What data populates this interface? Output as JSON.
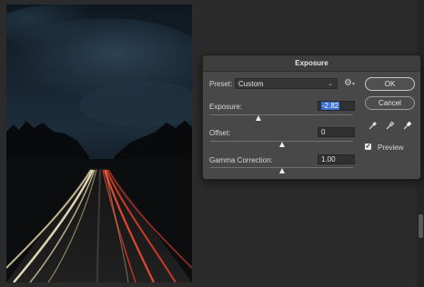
{
  "dialog": {
    "title": "Exposure",
    "preset_label": "Preset:",
    "preset_value": "Custom",
    "exposure": {
      "label": "Exposure:",
      "value": "-2.82",
      "level": 0.34
    },
    "offset": {
      "label": "Offset:",
      "value": "0",
      "level": 0.5
    },
    "gamma": {
      "label": "Gamma Correction:",
      "value": "1.00",
      "level": 0.5
    },
    "ok_label": "OK",
    "cancel_label": "Cancel",
    "preview_label": "Preview",
    "preview_checked": true
  },
  "icons": {
    "preset_menu": "gear-icon",
    "eyedroppers": [
      "black-point-eyedropper-icon",
      "gray-point-eyedropper-icon",
      "white-point-eyedropper-icon"
    ]
  },
  "colors": {
    "dialog_bg": "#484848",
    "selection": "#3a6fd1"
  }
}
